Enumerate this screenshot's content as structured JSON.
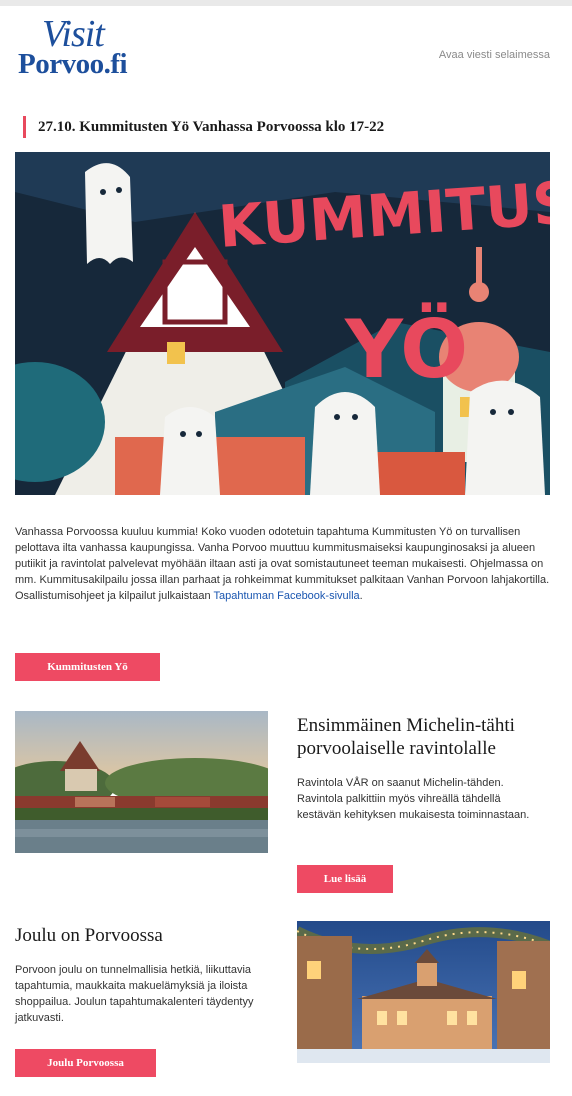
{
  "header": {
    "logo_line1": "Visit",
    "logo_line2": "Porvoo.fi",
    "browser_link": "Avaa viesti selaimessa"
  },
  "hero": {
    "headline": "27.10. Kummitusten Yö Vanhassa Porvoossa klo 17-22",
    "image_text_line1": "KUMMITUSTEN",
    "image_text_line2": "YÖ",
    "intro_text": "Vanhassa Porvoossa kuuluu kummia! Koko vuoden odotetuin tapahtuma Kummitusten Yö on turvallisen pelottava ilta vanhassa kaupungissa. Vanha Porvoo muuttuu kummitusmaiseksi kaupunginosaksi ja alueen putiikit ja ravintolat palvelevat myöhään iltaan asti ja ovat somistautuneet teeman mukaisesti. Ohjelmassa on mm. Kummitusakilpailu jossa illan parhaat ja rohkeimmat kummitukset palkitaan Vanhan Porvoon lahjakortilla. Osallistumisohjeet ja kilpailut julkaistaan",
    "intro_link": "Tapahtuman Facebook-sivulla",
    "intro_end": ".",
    "button": "Kummitusten Yö"
  },
  "article1": {
    "title": "Ensimmäinen Michelin-tähti porvoolaiselle ravintolalle",
    "text": "Ravintola VÅR on saanut Michelin-tähden. Ravintola palkittiin myös vihreällä tähdellä kestävän kehityksen mukaisesta toiminnastaan.",
    "button": "Lue lisää"
  },
  "article2": {
    "title": "Joulu on Porvoossa",
    "text": "Porvoon joulu on tunnelmallisia hetkiä, liikuttavia tapahtumia, maukkaita makuelämyksiä ja iloista shoppailua. Joulun tapahtumakalenteri täydentyy jatkuvasti.",
    "button": "Joulu Porvoossa"
  },
  "colors": {
    "brand_blue": "#1d4f9c",
    "accent_red": "#ee4a63",
    "link_blue": "#1a56b0"
  }
}
